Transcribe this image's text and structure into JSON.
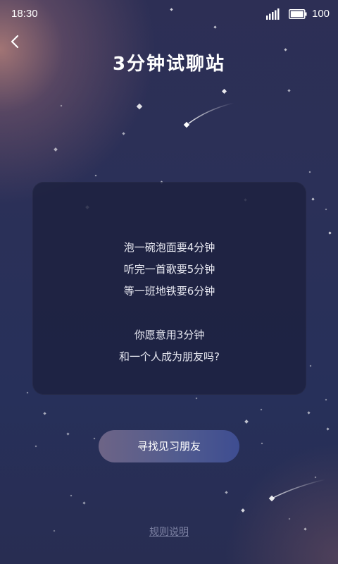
{
  "status_bar": {
    "time": "18:30",
    "battery_level": "100",
    "icons": [
      "signal-icon",
      "battery-icon"
    ]
  },
  "header": {
    "title": "3分钟试聊站",
    "back_icon": "chevron-left-icon"
  },
  "card": {
    "lines": [
      "泡一碗泡面要4分钟",
      "听完一首歌要5分钟",
      "等一班地铁要6分钟"
    ],
    "question_lines": [
      "你愿意用3分钟",
      "和一个人成为朋友吗?"
    ]
  },
  "actions": {
    "find_friend_label": "寻找见习朋友",
    "rules_label": "规则说明"
  },
  "colors": {
    "background": "#2b3058",
    "card": "#1c203e",
    "button_start": "#6d6486",
    "button_end": "#3e4d91",
    "rules_link": "#7d82a3"
  }
}
